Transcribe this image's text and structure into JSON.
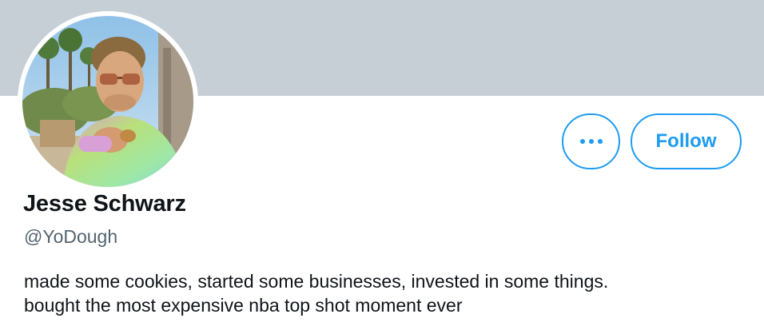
{
  "profile": {
    "display_name": "Jesse Schwarz",
    "handle": "@YoDough",
    "bio_lines": [
      "made some cookies, started some businesses, invested in some things.",
      "bought the most expensive nba top shot moment ever"
    ],
    "avatar_alt": "profile photo"
  },
  "actions": {
    "more_icon": "more-horizontal-icon",
    "follow_label": "Follow"
  },
  "colors": {
    "banner": "#c7cfd6",
    "accent": "#1d9bf0",
    "text_primary": "#0f1419",
    "text_secondary": "#536471"
  }
}
